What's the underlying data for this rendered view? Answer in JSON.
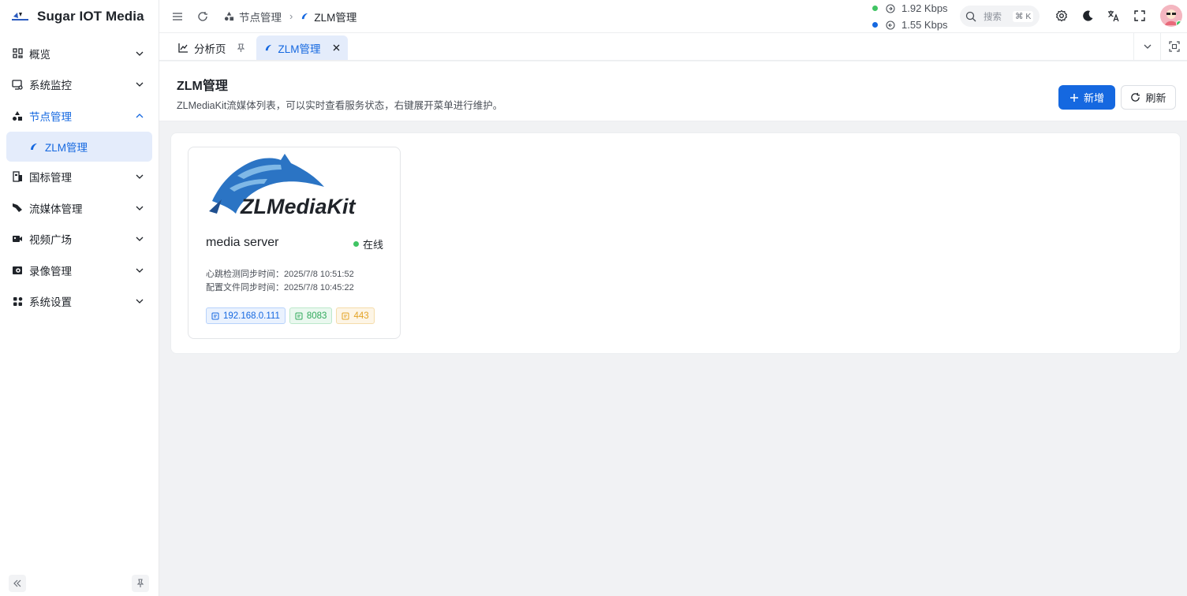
{
  "app": {
    "title": "Sugar IOT Media"
  },
  "sidebar": {
    "items": [
      {
        "label": "概览",
        "icon": "grid-icon"
      },
      {
        "label": "系统监控",
        "icon": "monitor-icon"
      },
      {
        "label": "节点管理",
        "icon": "nodes-icon",
        "expanded": true,
        "active": true
      },
      {
        "label": "国标管理",
        "icon": "building-icon"
      },
      {
        "label": "流媒体管理",
        "icon": "stream-icon"
      },
      {
        "label": "视频广场",
        "icon": "video-icon"
      },
      {
        "label": "录像管理",
        "icon": "record-icon"
      },
      {
        "label": "系统设置",
        "icon": "settings-grid-icon"
      }
    ],
    "subitem": {
      "label": "ZLM管理"
    }
  },
  "header": {
    "breadcrumb": {
      "parent": "节点管理",
      "current": "ZLM管理"
    },
    "speed_up": "1.92 Kbps",
    "speed_down": "1.55 Kbps",
    "search_placeholder": "搜索",
    "search_shortcut": "⌘ K"
  },
  "tabs": [
    {
      "label": "分析页",
      "pinned": true
    },
    {
      "label": "ZLM管理",
      "active": true
    }
  ],
  "page": {
    "title": "ZLM管理",
    "description": "ZLMediaKit流媒体列表，可以实时查看服务状态，右键展开菜单进行维护。",
    "add_label": "新增",
    "refresh_label": "刷新"
  },
  "server": {
    "logo_text": "ZLMediaKit",
    "name": "media server",
    "status": "在线",
    "heartbeat": "心跳检测同步时间：2025/7/8 10:51:52",
    "config_sync": "配置文件同步时间：2025/7/8 10:45:22",
    "ip": "192.168.0.111",
    "http_port": "8083",
    "https_port": "443"
  },
  "colors": {
    "accent": "#1568e0",
    "online": "#40c463",
    "tag_green": "#2fa85a",
    "tag_orange": "#e3a325"
  }
}
